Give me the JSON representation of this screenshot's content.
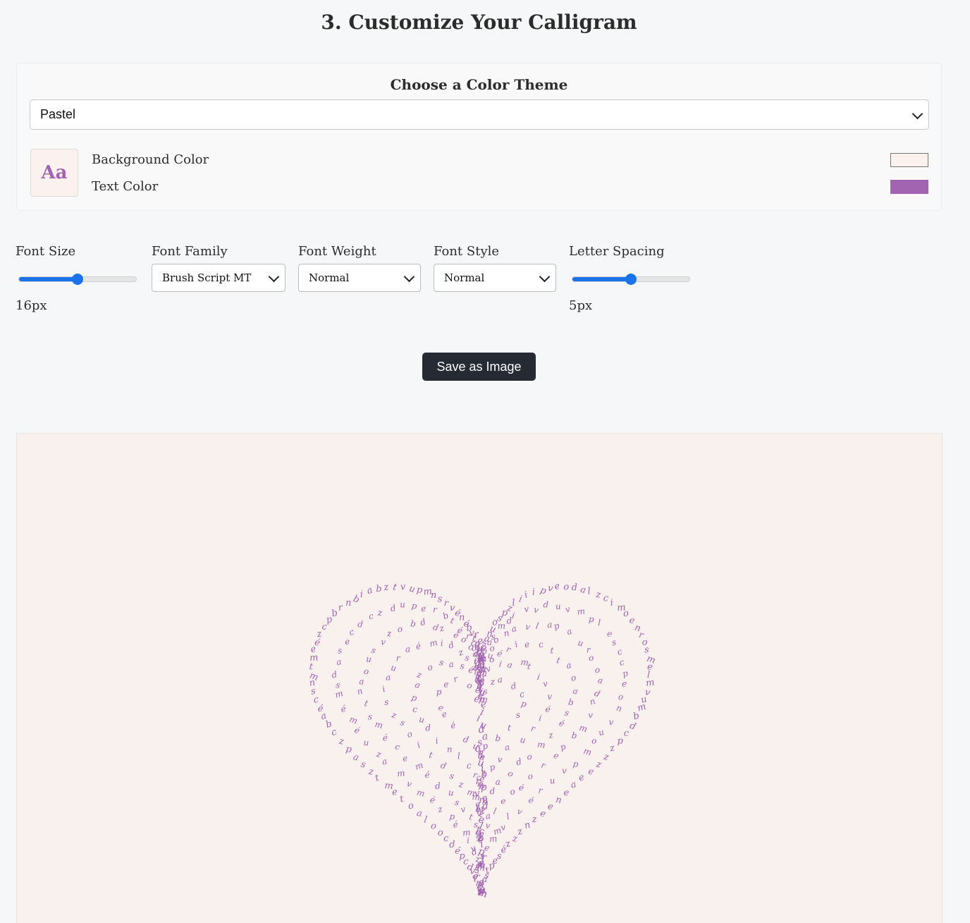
{
  "page": {
    "title": "3. Customize Your Calligram"
  },
  "theme": {
    "heading": "Choose a Color Theme",
    "selected": "Pastel",
    "preview_text": "Aa",
    "background_label": "Background Color",
    "text_label": "Text Color",
    "background_color": "#fbf1ef",
    "text_color": "#a264b0"
  },
  "controls": {
    "font_size": {
      "label": "Font Size",
      "value": "16px",
      "fraction": 0.5
    },
    "font_family": {
      "label": "Font Family",
      "selected": "Brush Script MT"
    },
    "font_weight": {
      "label": "Font Weight",
      "selected": "Normal"
    },
    "font_style": {
      "label": "Font Style",
      "selected": "Normal"
    },
    "letter_spacing": {
      "label": "Letter Spacing",
      "value": "5px",
      "fraction": 0.5
    }
  },
  "actions": {
    "save_label": "Save as Image"
  },
  "canvas": {
    "shape": "heart-icon",
    "colors": {
      "background": "#f9f1ee",
      "text": "#a264b0",
      "accent": "#1a73e8"
    }
  }
}
